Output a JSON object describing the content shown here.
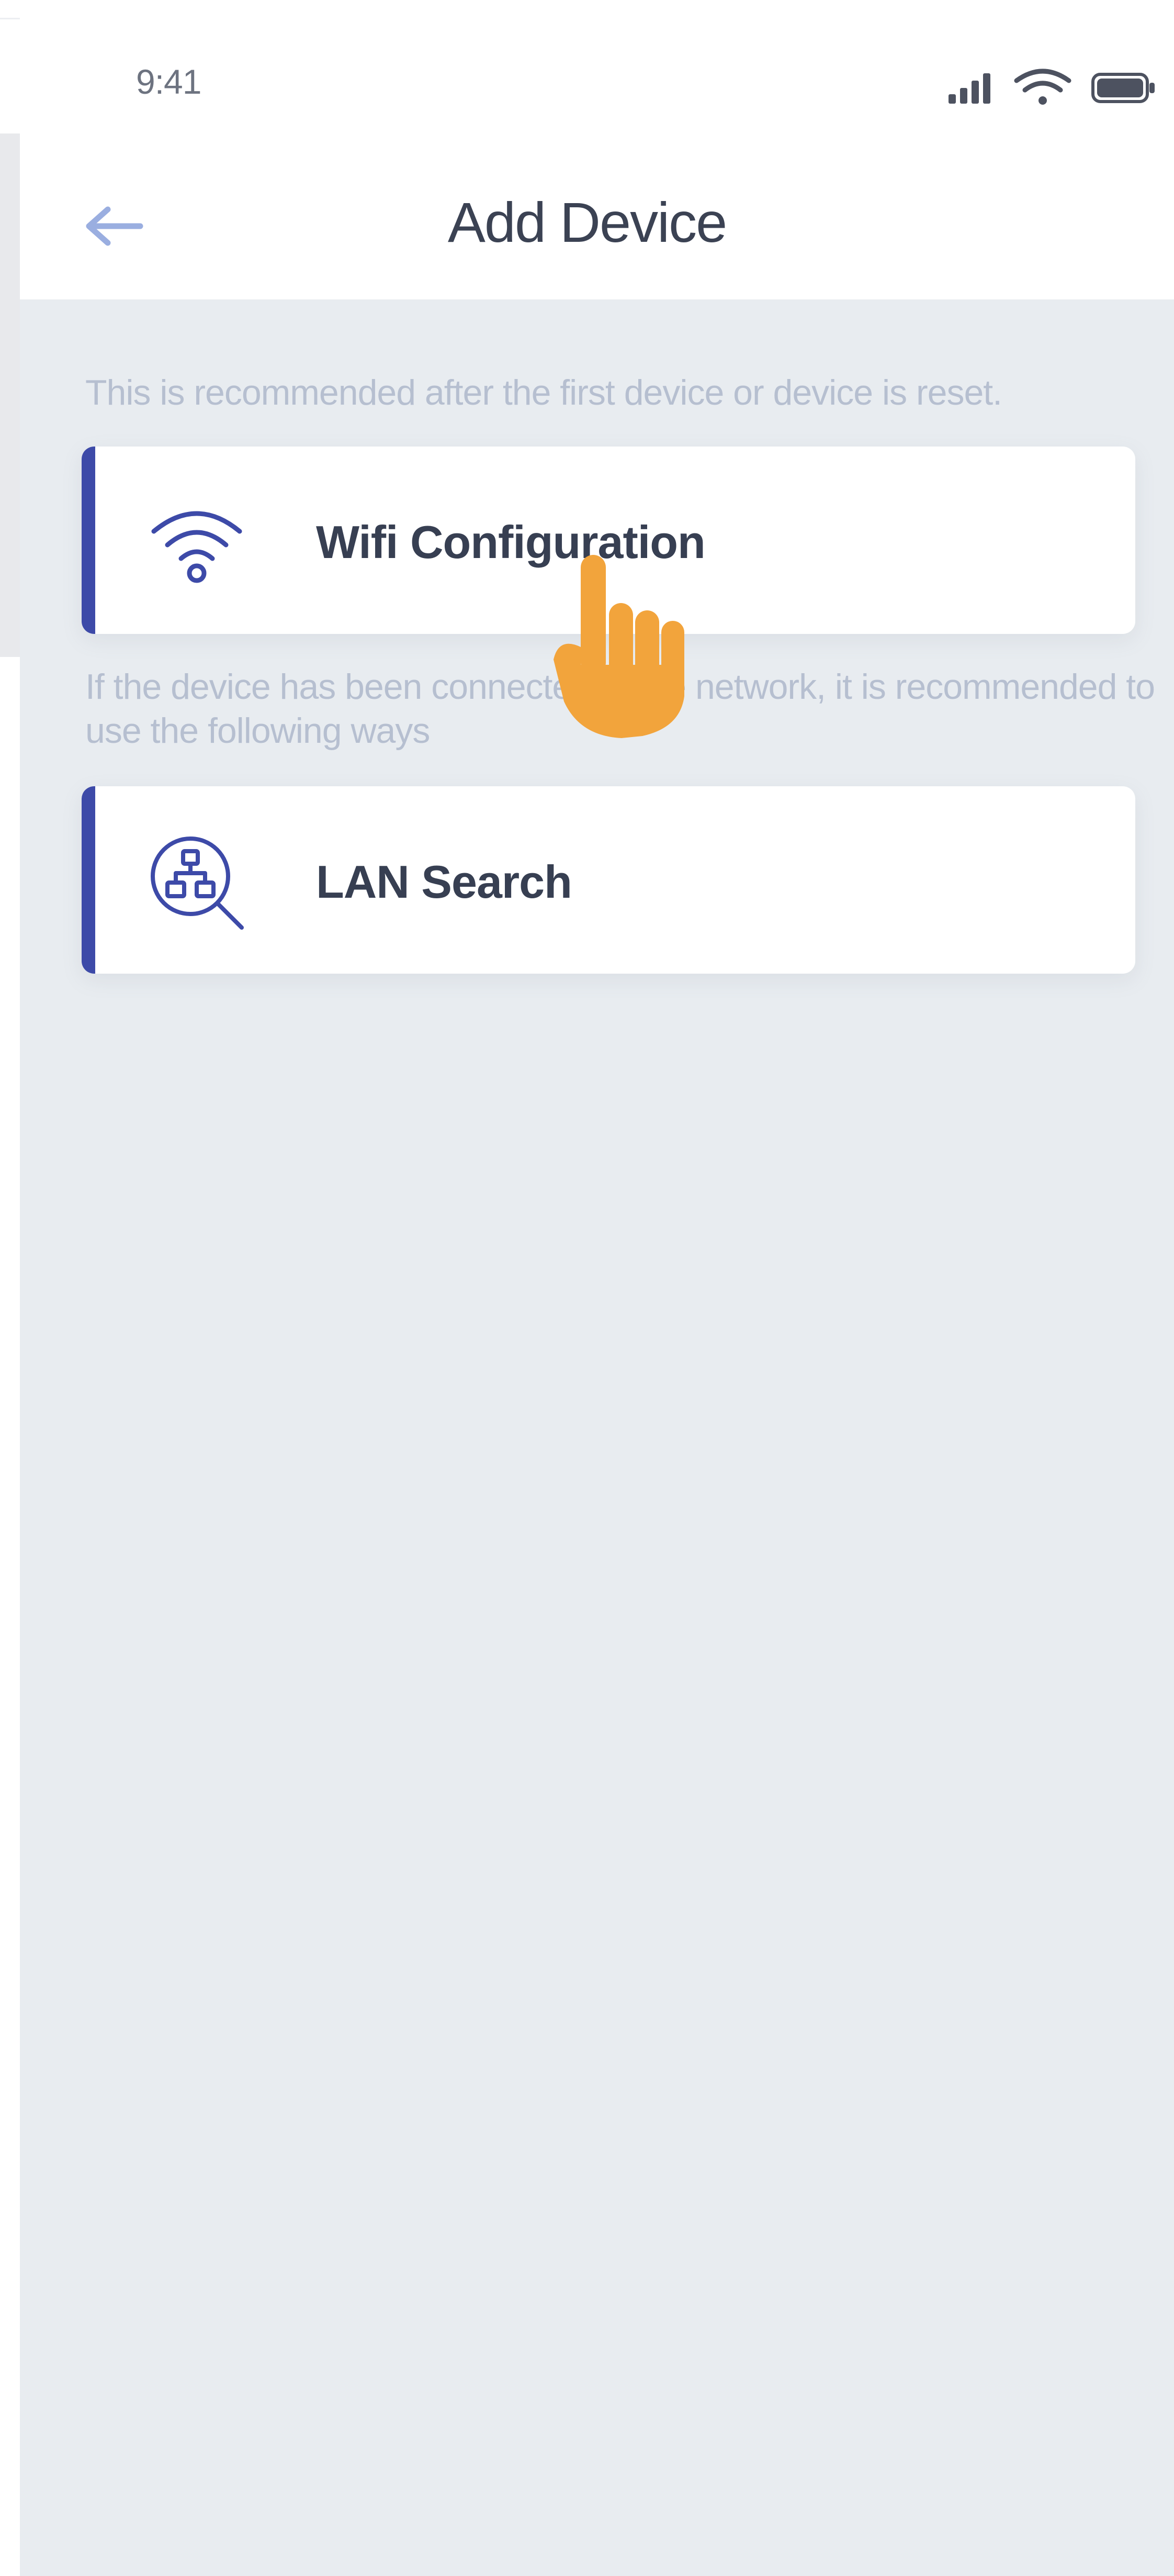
{
  "status_bar": {
    "time": "9:41"
  },
  "header": {
    "title": "Add Device",
    "back_icon": "arrow-left-icon"
  },
  "sections": [
    {
      "note": "This is recommended after the first device or device is reset.",
      "option": {
        "label": "Wifi Configuration",
        "icon": "wifi-icon"
      }
    },
    {
      "note": "If the device has been connected to the network, it is recommended to use the following ways",
      "option": {
        "label": "LAN Search",
        "icon": "network-search-icon"
      }
    }
  ],
  "colors": {
    "accent": "#3d4aa8",
    "background": "#e8ecf0",
    "note_text": "#b6bfd0",
    "title_text": "#3b4253",
    "back_arrow": "#9aaee0",
    "cursor": "#f2a43c"
  }
}
